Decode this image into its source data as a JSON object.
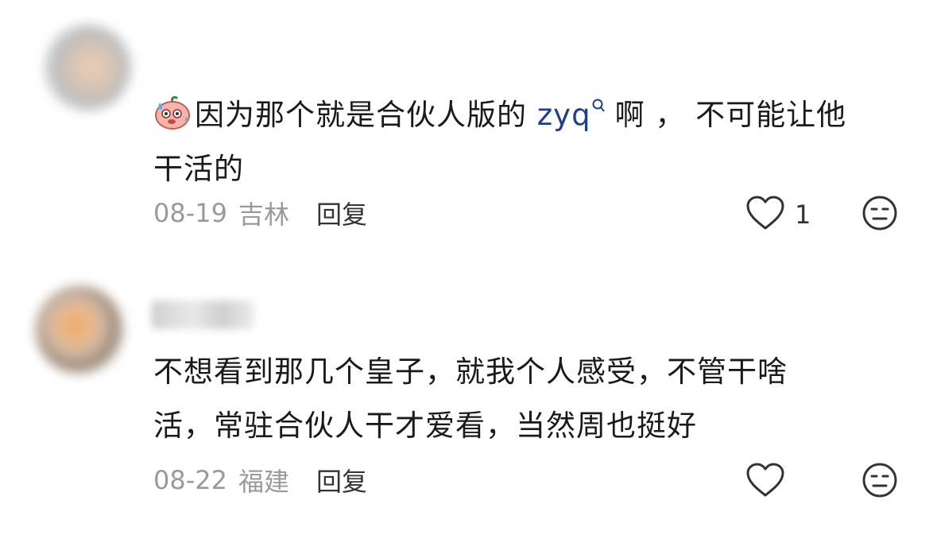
{
  "comments": [
    {
      "text_after_emoji": "因为那个就是合伙人版的",
      "mention": "zyq",
      "text_after_mention": "啊 ， 不可能让他",
      "text_line2": "干活的",
      "date": "08-19",
      "location": "吉林",
      "reply_label": "回复",
      "like_count": "1",
      "emoji_icon": "sweating-face-emoji",
      "like_icon": "heart-outline-icon",
      "reaction_icon": "neutral-face-icon"
    },
    {
      "text_line1": "不想看到那几个皇子，就我个人感受，不管干啥",
      "text_line2": "活，常驻合伙人干才爱看，当然周也挺好",
      "date": "08-22",
      "location": "福建",
      "reply_label": "回复",
      "like_count": "",
      "like_icon": "heart-outline-icon",
      "reaction_icon": "neutral-face-icon"
    }
  ],
  "colors": {
    "text": "#1a1a1a",
    "meta": "#9a9a9a",
    "mention": "#1f3f8a",
    "icon": "#333333"
  }
}
